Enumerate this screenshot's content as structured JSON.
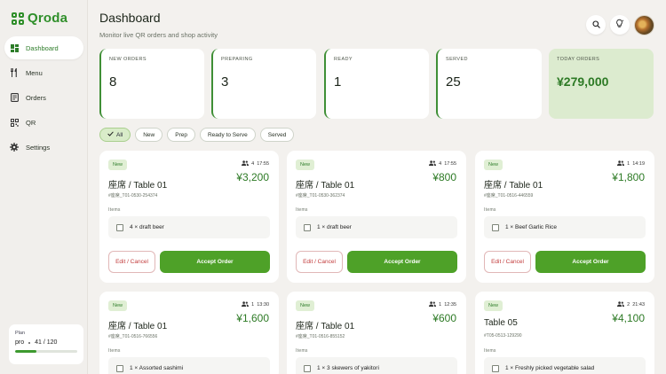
{
  "brand": {
    "name": "Qroda"
  },
  "sidebar": {
    "items": [
      {
        "label": "Dashboard",
        "icon": "dashboard-icon"
      },
      {
        "label": "Menu",
        "icon": "fork-knife-icon"
      },
      {
        "label": "Orders",
        "icon": "receipt-icon"
      },
      {
        "label": "QR",
        "icon": "qr-icon"
      },
      {
        "label": "Settings",
        "icon": "gear-icon"
      }
    ]
  },
  "plan": {
    "label": "Plan",
    "name": "pro",
    "usage": "41 / 120",
    "used": 41,
    "limit": 120
  },
  "header": {
    "title": "Dashboard",
    "subtitle": "Monitor live QR orders and shop activity"
  },
  "stats": [
    {
      "label": "NEW ORDERS",
      "value": "8"
    },
    {
      "label": "PREPARING",
      "value": "3"
    },
    {
      "label": "READY",
      "value": "1"
    },
    {
      "label": "SERVED",
      "value": "25"
    },
    {
      "label": "TODAY ORDERS",
      "value": "¥279,000"
    }
  ],
  "filters": [
    "All",
    "New",
    "Prep",
    "Ready to Serve",
    "Served"
  ],
  "orders": [
    {
      "badge": "New",
      "guests": "4",
      "time": "17:55",
      "price": "¥3,200",
      "title": "座席 / Table 01",
      "id": "#座席_T01-0530-254374",
      "items_label": "Items",
      "item": "4 × draft beer",
      "edit": "Edit / Cancel",
      "accept": "Accept Order"
    },
    {
      "badge": "New",
      "guests": "4",
      "time": "17:55",
      "price": "¥800",
      "title": "座席 / Table 01",
      "id": "#座席_T01-0530-362374",
      "items_label": "Items",
      "item": "1 × draft beer",
      "edit": "Edit / Cancel",
      "accept": "Accept Order"
    },
    {
      "badge": "New",
      "guests": "1",
      "time": "14:19",
      "price": "¥1,800",
      "title": "座席 / Table 01",
      "id": "#座席_T01-0516-446559",
      "items_label": "Items",
      "item": "1 × Beef Garlic Rice",
      "edit": "Edit / Cancel",
      "accept": "Accept Order"
    },
    {
      "badge": "New",
      "guests": "1",
      "time": "13:30",
      "price": "¥1,600",
      "title": "座席 / Table 01",
      "id": "#座席_T01-0516-766556",
      "items_label": "Items",
      "item": "1 × Assorted sashimi"
    },
    {
      "badge": "New",
      "guests": "1",
      "time": "12:35",
      "price": "¥600",
      "title": "座席 / Table 01",
      "id": "#座席_T01-0516-855152",
      "items_label": "Items",
      "item": "1 × 3 skewers of yakitori"
    },
    {
      "badge": "New",
      "guests": "2",
      "time": "21:43",
      "price": "¥4,100",
      "title": "Table 05",
      "id": "#T05-0513-129290",
      "items_label": "Items",
      "item": "1 × Freshly picked vegetable salad"
    }
  ]
}
